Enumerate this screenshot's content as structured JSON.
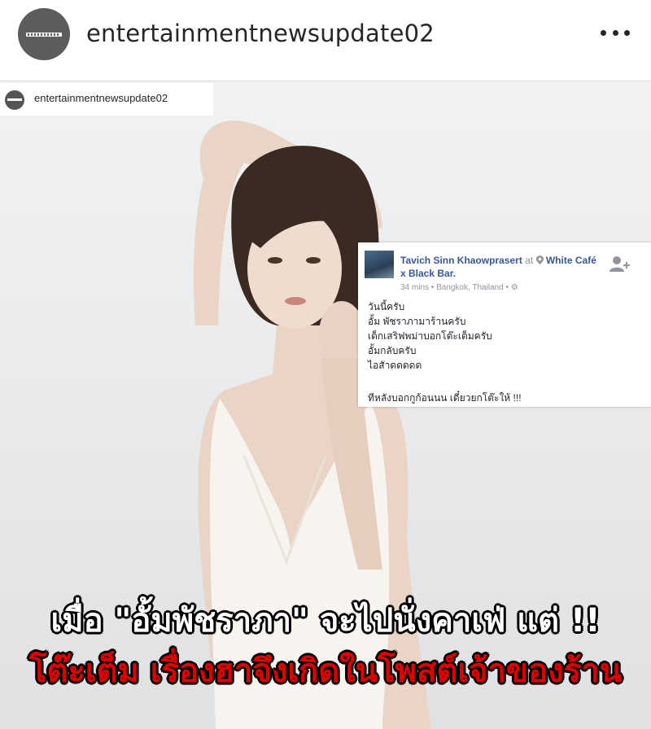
{
  "header": {
    "username": "entertainmentnewsupdate02",
    "avatar_icon": "account-avatar-icon",
    "more_icon": "more-options-icon"
  },
  "post": {
    "watermark_username": "entertainmentnewsupdate02",
    "facebook_card": {
      "author": "Tavich Sinn Khaowprasert",
      "at_text": "at",
      "place_icon": "location-pin-icon",
      "place": "White Café x Black Bar",
      "meta": "34 mins • Bangkok, Thailand • ⚙",
      "add_friend_icon": "add-friend-icon",
      "lines": [
        "วันนี้ครับ",
        "อั้ม พัชราภามาร้านครับ",
        "เด็กเสริฟพม่าบอกโต๊ะเต็มครับ",
        "อั้มกลับครับ",
        "ไอสัาดดดดด"
      ],
      "last_line": "ทีหลังบอกกูก้อนนน เดี๋ยวยกโต๊ะให้ !!!"
    },
    "caption_line1": "เมื่อ \"อั้มพัชราภา\" จะไปนั่งคาเฟ่ แต่ !!",
    "caption_line2": "โต๊ะเต็ม เรื่องฮาจึงเกิดในโพสต์เจ้าของร้าน"
  },
  "colors": {
    "caption_white": "#ffffff",
    "caption_red": "#e00000",
    "fb_link": "#365899",
    "outline": "#000000"
  }
}
